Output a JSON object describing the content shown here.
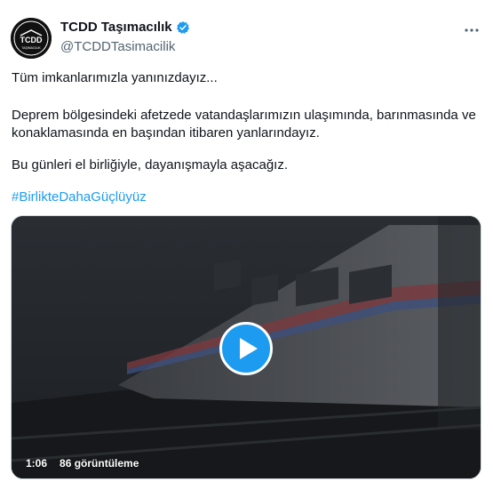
{
  "author": {
    "display_name": "TCDD Taşımacılık",
    "handle": "@TCDDTasimacilik",
    "logo_text": "TCDD",
    "logo_subtext": "TAŞIMACILIK",
    "verified_color": "#1d9bf0",
    "icons": {
      "avatar": "tcdd-logo",
      "verified": "verified-badge-icon",
      "more": "more-horizontal-icon"
    }
  },
  "tweet": {
    "line1": "Tüm imkanlarımızla yanınızdayız...",
    "line2": "Deprem bölgesindeki afetzede vatandaşlarımızın ulaşımında, barınmasında ve konaklamasında en başından itibaren yanlarındayız.",
    "line3": "Bu günleri el birliğiyle, dayanışmayla aşacağız.",
    "hashtag": "#BirlikteDahaGüçlüyüz",
    "hashtag_color": "#1d9bf0"
  },
  "video": {
    "duration": "1:06",
    "views": "86 görüntüleme",
    "play_icon": "play-icon",
    "accent_color": "#1d9bf0"
  }
}
